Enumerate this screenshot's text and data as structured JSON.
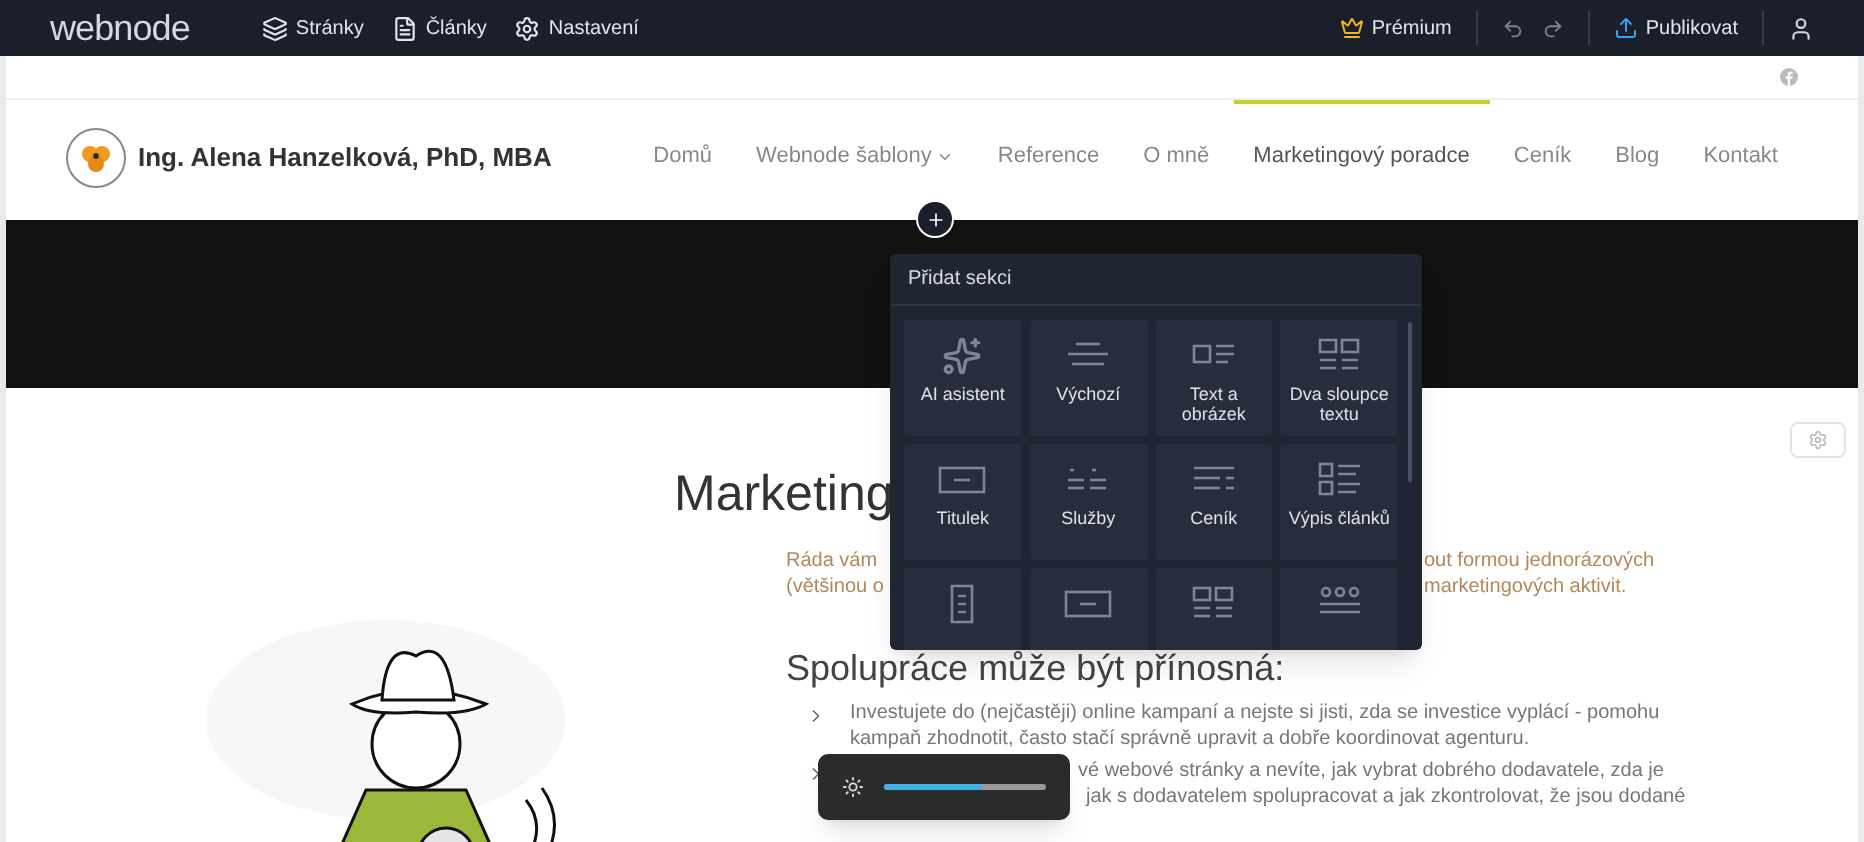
{
  "topbar": {
    "logo": "webnode",
    "menu": [
      {
        "label": "Stránky",
        "kind": "pages"
      },
      {
        "label": "Články",
        "kind": "articles"
      },
      {
        "label": "Nastavení",
        "kind": "settings"
      }
    ],
    "premium": "Prémium",
    "publish": "Publikovat"
  },
  "site": {
    "name": "Ing. Alena Hanzelková, PhD, MBA",
    "nav": [
      {
        "label": "Domů",
        "selected": false,
        "dropdown": false
      },
      {
        "label": "Webnode šablony",
        "selected": false,
        "dropdown": true
      },
      {
        "label": "Reference",
        "selected": false,
        "dropdown": false
      },
      {
        "label": "O mně",
        "selected": false,
        "dropdown": false
      },
      {
        "label": "Marketingový poradce",
        "selected": true,
        "dropdown": false
      },
      {
        "label": "Ceník",
        "selected": false,
        "dropdown": false
      },
      {
        "label": "Blog",
        "selected": false,
        "dropdown": false
      },
      {
        "label": "Kontakt",
        "selected": false,
        "dropdown": false
      }
    ]
  },
  "content": {
    "title": "Marketing",
    "intro": [
      {
        "left": "Ráda vám",
        "right": "out formou jednorázových"
      },
      {
        "left": "(většinou o",
        "right": "marketingových aktivit."
      }
    ],
    "heading": "Spolupráce může být přínosná:",
    "bullets": [
      {
        "lines": [
          "Investujete do (nejčastěji) online kampaní a nejste si jisti, zda se investice vyplácí - pomohu",
          "kampaň zhodnotit, často stačí správně upravit a dobře koordinovat agenturu."
        ]
      },
      {
        "lines": [
          "vé webové stránky a nevíte, jak vybrat dobrého dodavatele, zda je",
          "jak s dodavatelem spolupracovat a jak zkontrolovat, že jsou dodané"
        ]
      }
    ]
  },
  "add_section": {
    "title": "Přidat sekci",
    "tiles": [
      {
        "kind": "ai",
        "label": "AI asistent"
      },
      {
        "kind": "default",
        "label": "Výchozí"
      },
      {
        "kind": "text_image",
        "label": "Text a obrázek"
      },
      {
        "kind": "two_columns",
        "label": "Dva sloupce textu"
      },
      {
        "kind": "title",
        "label": "Titulek"
      },
      {
        "kind": "services",
        "label": "Služby"
      },
      {
        "kind": "pricing",
        "label": "Ceník"
      },
      {
        "kind": "articles",
        "label": "Výpis článků"
      },
      {
        "kind": "form"
      },
      {
        "kind": "title"
      },
      {
        "kind": "two_columns"
      },
      {
        "kind": "grid"
      }
    ]
  },
  "brightness": {
    "level": 0.6
  }
}
